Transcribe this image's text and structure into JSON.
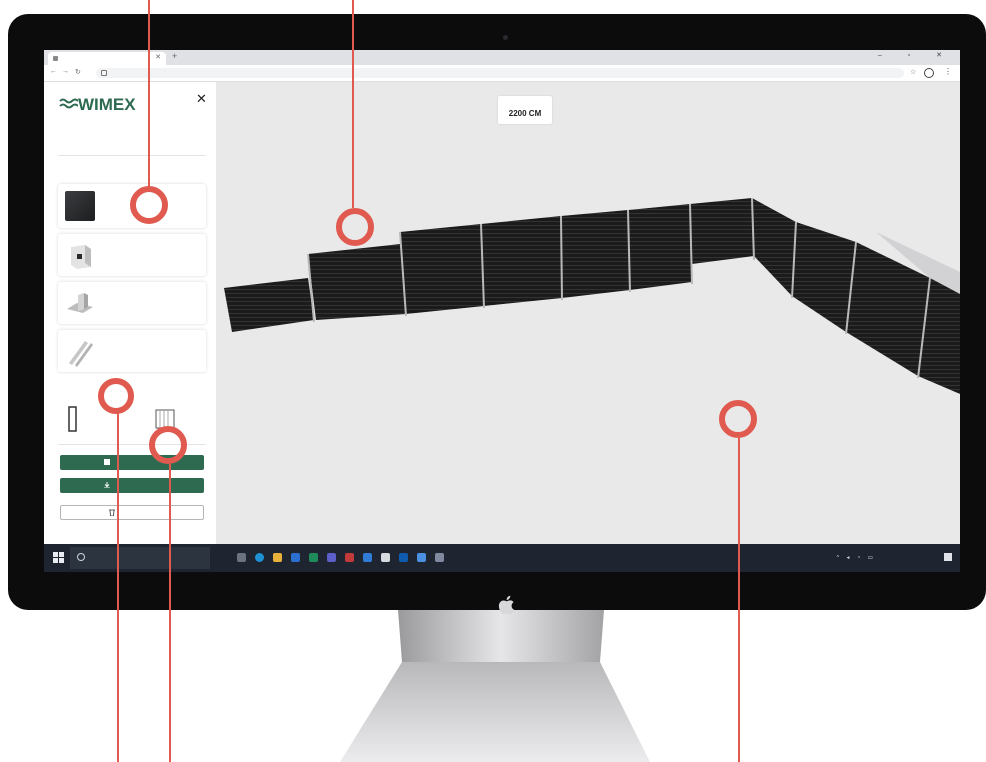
{
  "browser": {
    "tab_title": "",
    "url": "",
    "window_controls": "–  ▫  ✕"
  },
  "sidebar": {
    "brand": "WIMEX",
    "intro": "",
    "section_label": "",
    "cards": [
      {
        "key": "slats",
        "title": "",
        "subtitle": ""
      },
      {
        "key": "post",
        "title": "",
        "subtitle": ""
      },
      {
        "key": "post-foot",
        "title": "",
        "subtitle": ""
      },
      {
        "key": "rails",
        "title": "",
        "subtitle": ""
      }
    ],
    "height_label": "",
    "height_value": "",
    "primary_buttons": [
      "",
      ""
    ],
    "delete_label": ""
  },
  "viewport": {
    "height_caption": "",
    "height_value": "2200 CM"
  },
  "taskbar": {
    "search_placeholder": "",
    "clock_time": "",
    "clock_date": ""
  },
  "colors": {
    "brand_green": "#2d6a50",
    "annotation_red": "#e05a4f",
    "slat_dark": "#1b1b1b",
    "viewport_bg": "#e9e9ea",
    "bezel": "#0c0c0d"
  },
  "icons": [
    "apple-logo-icon",
    "close-icon",
    "lock-icon",
    "star-icon",
    "profile-icon",
    "windows-start-icon",
    "search-icon",
    "save-icon",
    "download-icon",
    "trash-icon"
  ]
}
